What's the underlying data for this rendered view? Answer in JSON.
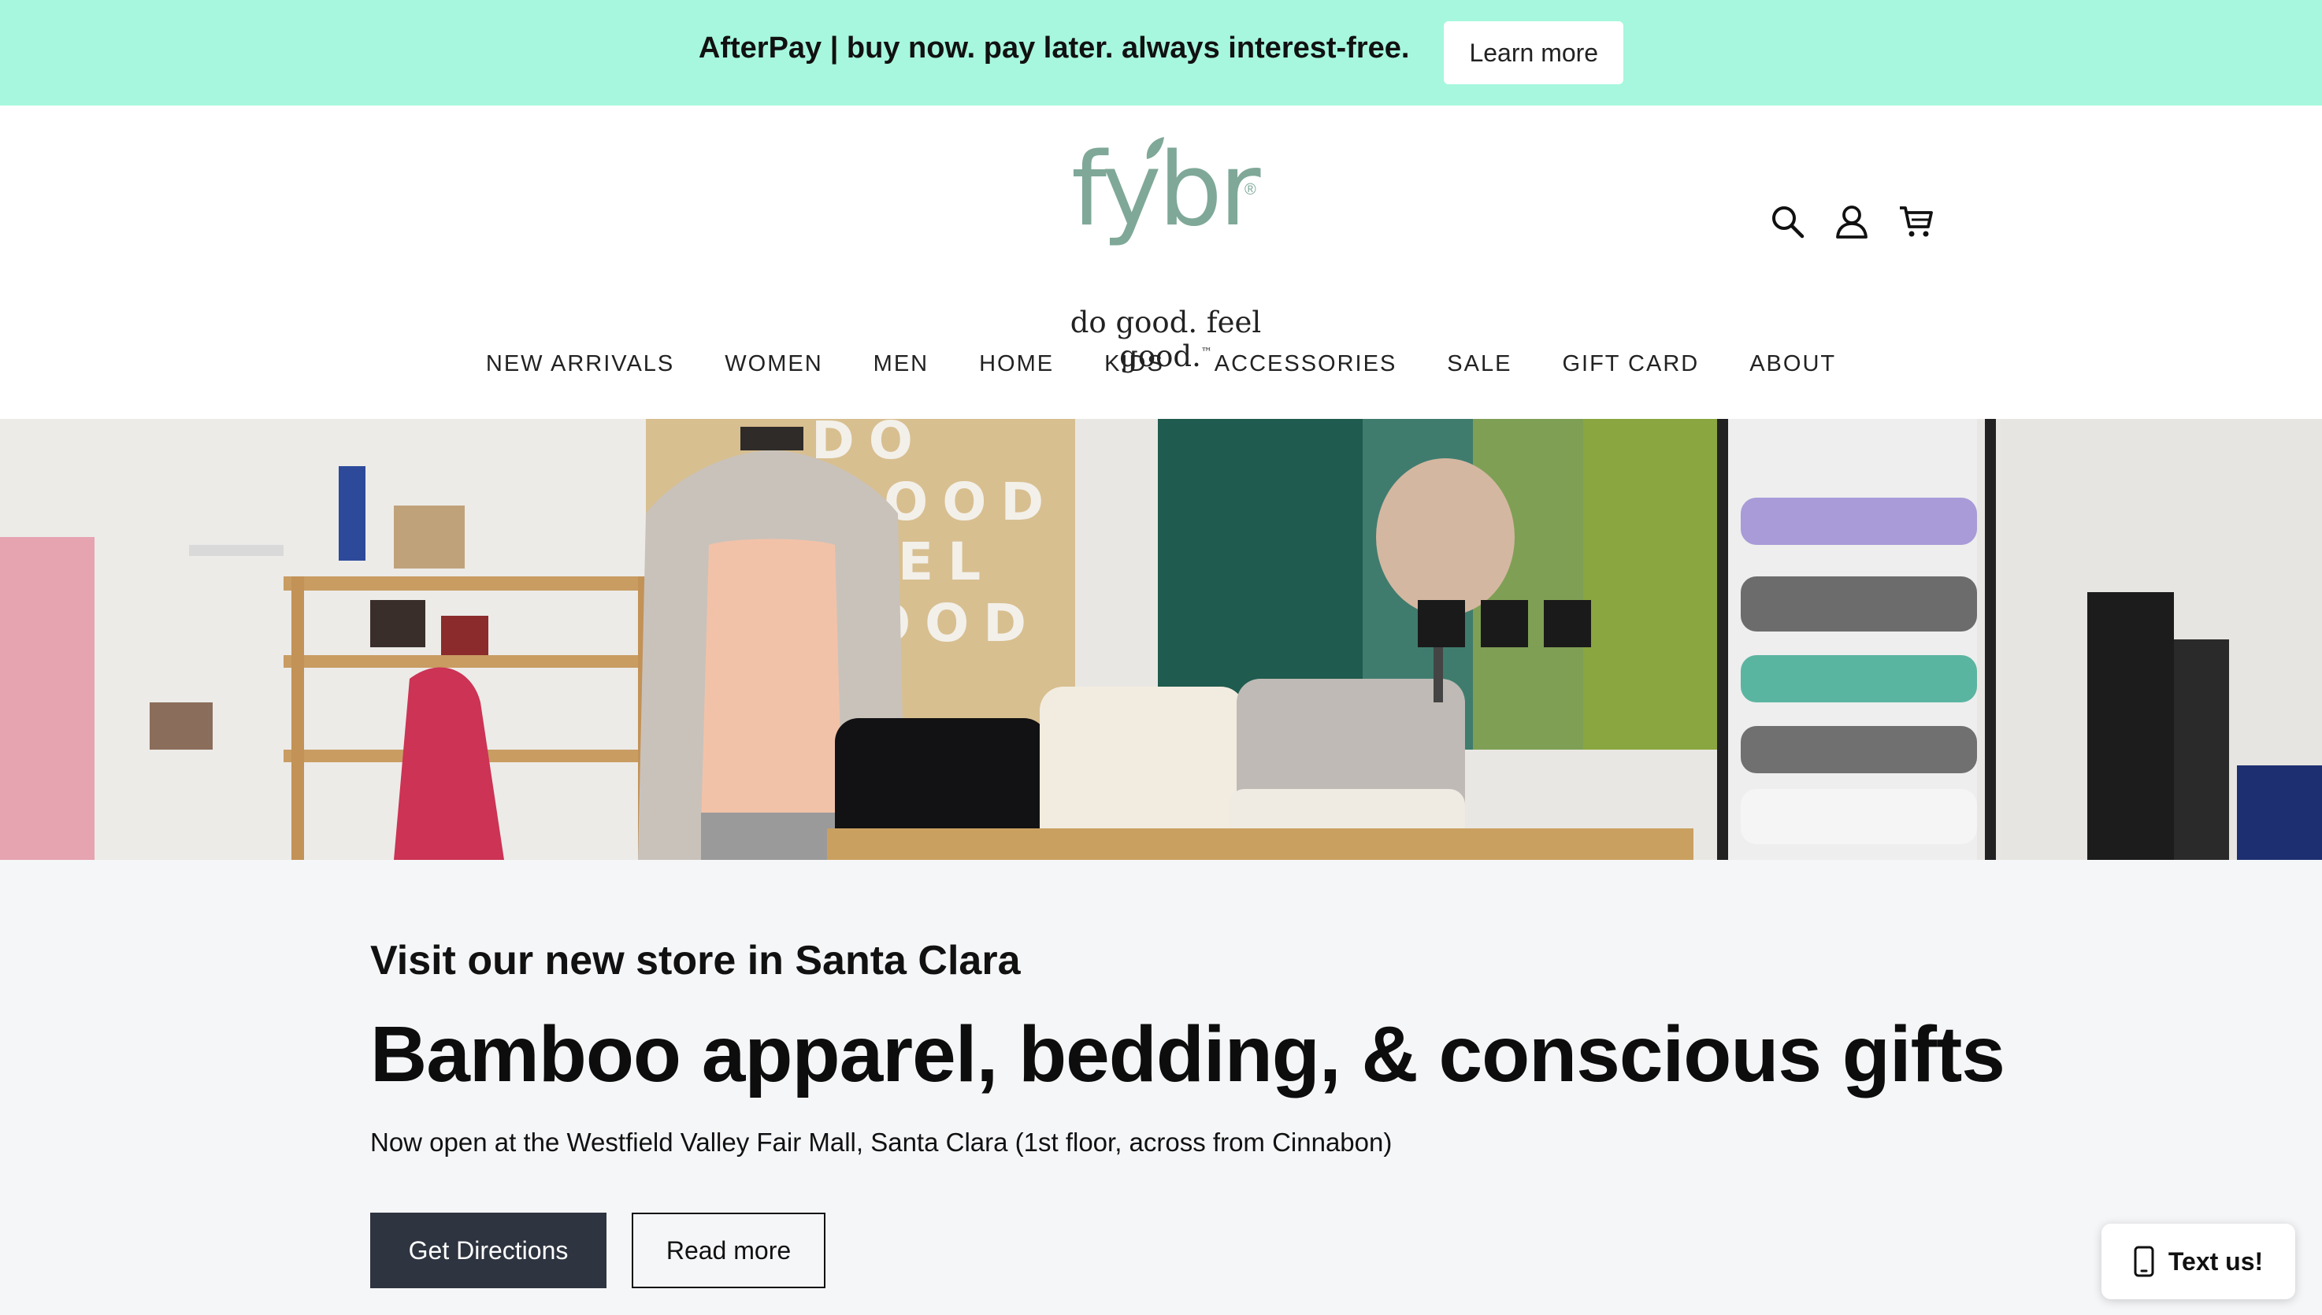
{
  "promo": {
    "text": "AfterPay | buy now. pay later. always interest-free.",
    "button_label": "Learn more"
  },
  "header": {
    "logo_text": "fybr",
    "logo_reg": "®",
    "tagline": "do good. feel good.",
    "tagline_tm": "™",
    "icons": [
      "search-icon",
      "account-icon",
      "cart-icon"
    ]
  },
  "nav": {
    "items": [
      "NEW ARRIVALS",
      "WOMEN",
      "MEN",
      "HOME",
      "KIDS",
      "ACCESSORIES",
      "SALE",
      "GIFT CARD",
      "ABOUT"
    ]
  },
  "hero": {
    "wall_text": [
      "DO",
      "GOOD",
      "EL",
      "OOD"
    ],
    "colors": {
      "sage": "#7fa898",
      "mint": "#a6f7dd"
    }
  },
  "content": {
    "kicker": "Visit our new store in Santa Clara",
    "headline": "Bamboo apparel, bedding, & conscious gifts",
    "sub": "Now open at the Westfield Valley Fair Mall, Santa Clara (1st floor, across from Cinnabon)",
    "primary_button": "Get Directions",
    "secondary_button": "Read more"
  },
  "chat_widget": {
    "label": "Text us!",
    "icon": "phone-icon"
  }
}
